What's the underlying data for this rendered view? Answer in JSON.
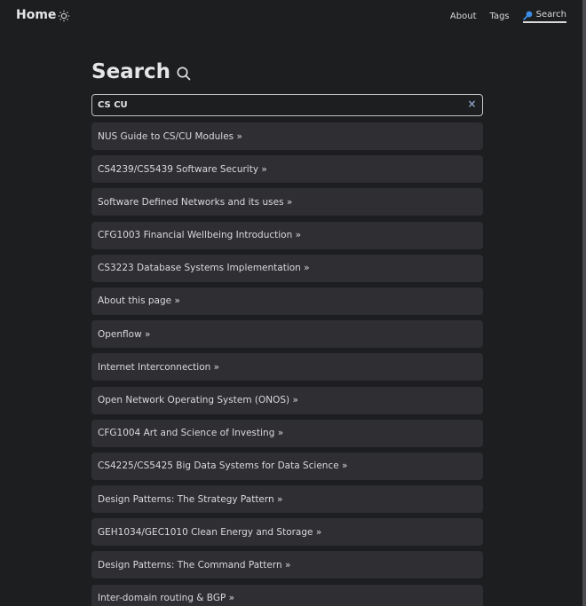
{
  "header": {
    "home_label": "Home",
    "nav": [
      {
        "label": "About"
      },
      {
        "label": "Tags"
      },
      {
        "label": "Search",
        "active": true
      }
    ]
  },
  "main": {
    "title": "Search",
    "search": {
      "value": "CS CU",
      "clear_icon": "close-icon"
    },
    "results": [
      "NUS Guide to CS/CU Modules »",
      "CS4239/CS5439 Software Security »",
      "Software Defined Networks and its uses »",
      "CFG1003 Financial Wellbeing Introduction »",
      "CS3223 Database Systems Implementation »",
      "About this page »",
      "Openflow »",
      "Internet Interconnection »",
      "Open Network Operating System (ONOS) »",
      "CFG1004 Art and Science of Investing »",
      "CS4225/CS5425 Big Data Systems for Data Science »",
      "Design Patterns: The Strategy Pattern »",
      "GEH1034/GEC1010 Clean Energy and Storage »",
      "Design Patterns: The Command Pattern »",
      "Inter-domain routing & BGP »"
    ]
  },
  "colors": {
    "background": "#1d1e20",
    "card": "#2e2e33",
    "text": "#dadadb",
    "accent": "#3a8ee6"
  }
}
